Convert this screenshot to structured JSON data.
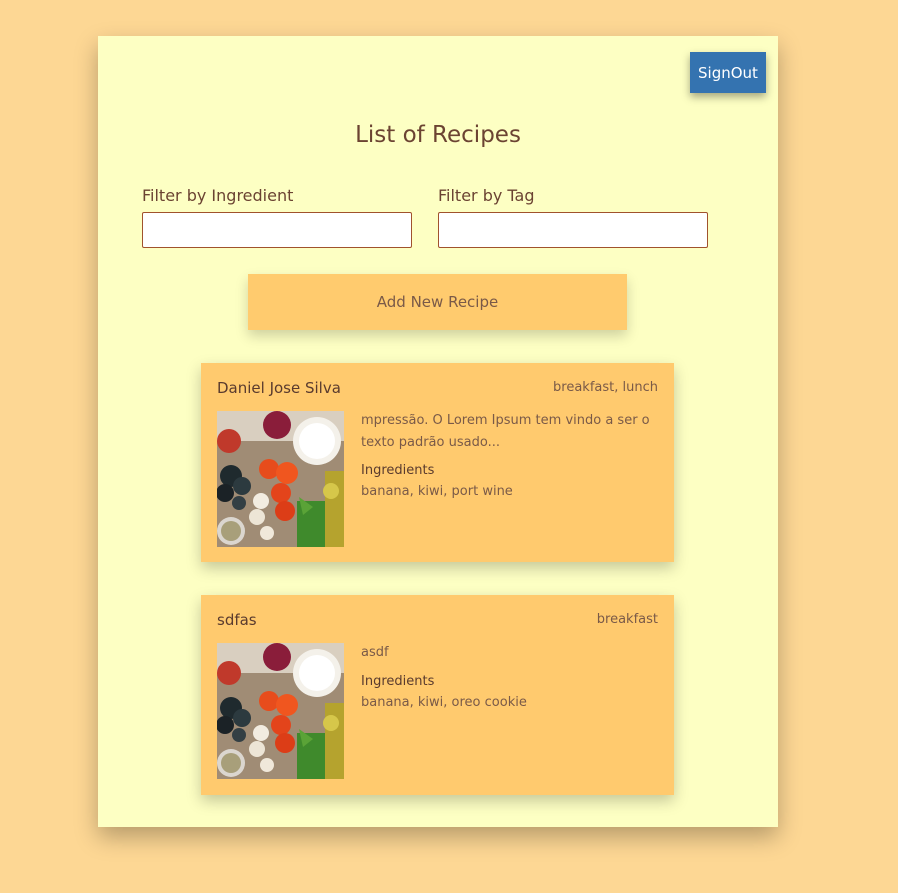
{
  "header": {
    "signout_label": "SignOut",
    "title": "List of Recipes"
  },
  "filters": {
    "ingredient_label": "Filter by Ingredient",
    "ingredient_value": "",
    "tag_label": "Filter by Tag",
    "tag_value": ""
  },
  "add_button_label": "Add New Recipe",
  "recipes": [
    {
      "name": "Daniel Jose Silva",
      "tags": "breakfast, lunch",
      "description": "mpressão. O Lorem Ipsum tem vindo a ser o texto padrão usado...",
      "ingredients_label": "Ingredients",
      "ingredients": "banana, kiwi, port wine",
      "image": "vegetables-photo"
    },
    {
      "name": "sdfas",
      "tags": "breakfast",
      "description": "asdf",
      "ingredients_label": "Ingredients",
      "ingredients": "banana, kiwi, oreo cookie",
      "image": "vegetables-photo"
    }
  ],
  "colors": {
    "page_background": "#fdd794",
    "panel_background": "#fdffc3",
    "signout_button": "#3473b0",
    "card_background": "#ffca6e",
    "text_brown": "#6b4332"
  }
}
